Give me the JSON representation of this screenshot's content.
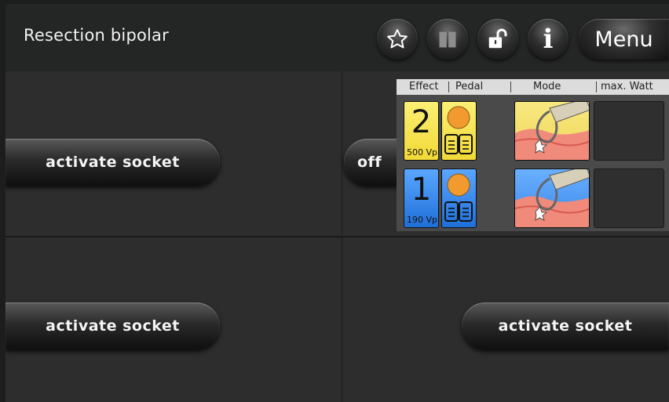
{
  "header": {
    "title": "Resection bipolar",
    "menu_label": "Menu",
    "icons": [
      "star-icon",
      "book-icon",
      "unlock-icon",
      "info-icon"
    ]
  },
  "sockets": {
    "top_left_label": "activate socket",
    "bottom_left_label": "activate socket",
    "bottom_right_label": "activate socket",
    "off_label": "off"
  },
  "channel_panel": {
    "columns": [
      "Effect",
      "Pedal",
      "Mode",
      "max. Watt"
    ],
    "rows": [
      {
        "effect": "2",
        "voltage": "500 Vp",
        "color": "#f7e64a"
      },
      {
        "effect": "1",
        "voltage": "190 Vp",
        "color": "#2f86ee"
      }
    ]
  },
  "colors": {
    "yellow_accent": "#f7e64a",
    "blue_accent": "#2f86ee",
    "pedal_orange": "#f29a2e"
  }
}
